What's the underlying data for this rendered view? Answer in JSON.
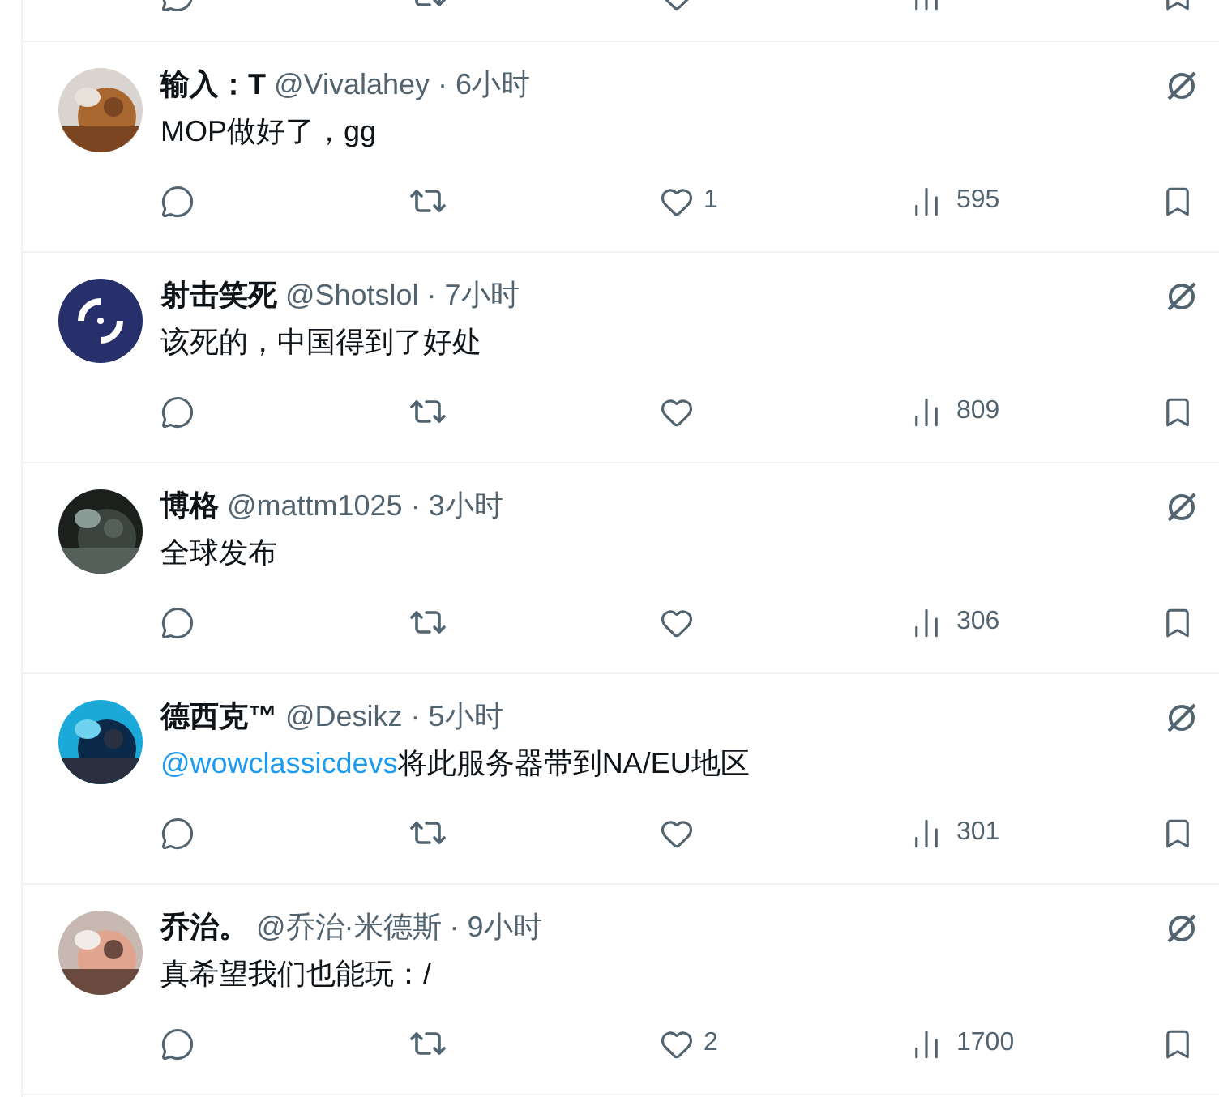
{
  "previous_reply": {
    "kind": "cut"
  },
  "replies": [
    {
      "name": "输入：T",
      "meta": "@Vivalahey · 6小时",
      "text": "MOP做好了，gg",
      "likes": "1",
      "views": "595"
    },
    {
      "avatar": {
        "kind": "logo"
      },
      "name": "射击笑死",
      "meta": "@Shotslol · 7小时",
      "text": "该死的，中国得到了好处",
      "views": "809"
    },
    {
      "name": "博格",
      "meta": "@mattm1025 · 3小时",
      "text": "全球发布",
      "views": "306"
    },
    {
      "name": "德西克™",
      "meta": "@Desikz · 5小时",
      "mention": "@wowclassicdevs",
      "text": "将此服务器带到NA/EU地区",
      "views": "301"
    },
    {
      "name": "乔治。",
      "meta": "@乔治·米德斯 · 9小时",
      "text": "真希望我们也能玩：/",
      "likes": "2",
      "views": "1700"
    }
  ]
}
